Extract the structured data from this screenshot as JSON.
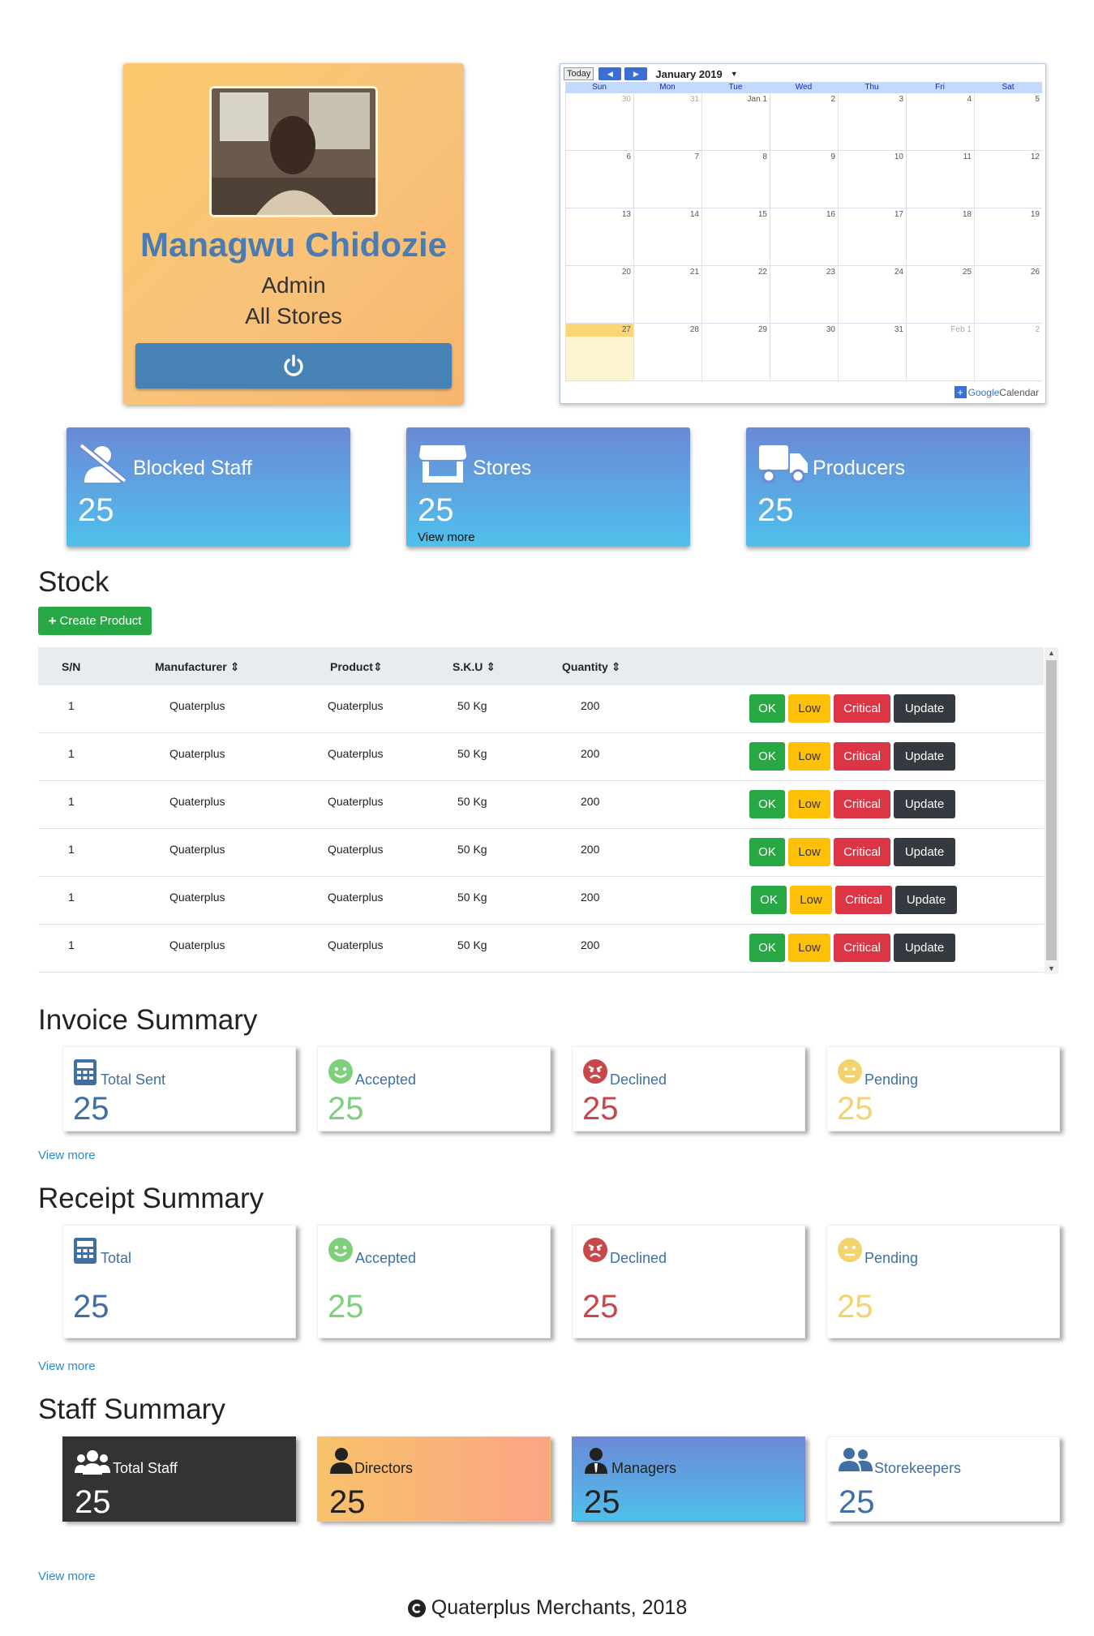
{
  "profile": {
    "name": "Managwu Chidozie",
    "role": "Admin",
    "store": "All Stores",
    "logout_icon": "power-icon"
  },
  "calendar": {
    "today_label": "Today",
    "month": "January 2019",
    "days_of_week": [
      "Sun",
      "Mon",
      "Tue",
      "Wed",
      "Thu",
      "Fri",
      "Sat"
    ],
    "weeks": [
      [
        "30",
        "31",
        "Jan 1",
        "2",
        "3",
        "4",
        "5"
      ],
      [
        "6",
        "7",
        "8",
        "9",
        "10",
        "11",
        "12"
      ],
      [
        "13",
        "14",
        "15",
        "16",
        "17",
        "18",
        "19"
      ],
      [
        "20",
        "21",
        "22",
        "23",
        "24",
        "25",
        "26"
      ],
      [
        "27",
        "28",
        "29",
        "30",
        "31",
        "Feb 1",
        "2"
      ]
    ],
    "highlight": "27",
    "brand_google": "Google",
    "brand_calendar": "Calendar"
  },
  "stats": [
    {
      "icon": "user-slash-icon",
      "label": "Blocked Staff",
      "value": "25",
      "more": ""
    },
    {
      "icon": "store-icon",
      "label": "Stores",
      "value": "25",
      "more": "View more"
    },
    {
      "icon": "truck-icon",
      "label": "Producers",
      "value": "25",
      "more": ""
    }
  ],
  "stock": {
    "title": "Stock",
    "create_label": "Create Product",
    "columns": [
      "S/N",
      "Manufacturer",
      "Product",
      "S.K.U",
      "Quantity"
    ],
    "rows": [
      {
        "sn": "1",
        "manufacturer": "Quaterplus",
        "product": "Quaterplus",
        "sku": "50 Kg",
        "quantity": "200"
      },
      {
        "sn": "1",
        "manufacturer": "Quaterplus",
        "product": "Quaterplus",
        "sku": "50 Kg",
        "quantity": "200"
      },
      {
        "sn": "1",
        "manufacturer": "Quaterplus",
        "product": "Quaterplus",
        "sku": "50 Kg",
        "quantity": "200"
      },
      {
        "sn": "1",
        "manufacturer": "Quaterplus",
        "product": "Quaterplus",
        "sku": "50 Kg",
        "quantity": "200"
      },
      {
        "sn": "1",
        "manufacturer": "Quaterplus",
        "product": "Quaterplus",
        "sku": "50 Kg",
        "quantity": "200"
      },
      {
        "sn": "1",
        "manufacturer": "Quaterplus",
        "product": "Quaterplus",
        "sku": "50 Kg",
        "quantity": "200"
      }
    ],
    "actions": {
      "ok": "OK",
      "low": "Low",
      "critical": "Critical",
      "update": "Update"
    }
  },
  "invoice": {
    "title": "Invoice Summary",
    "cards": [
      {
        "icon": "calculator-icon",
        "label": "Total Sent",
        "value": "25",
        "color": "#3f6fa3"
      },
      {
        "icon": "smile-icon",
        "label": "Accepted",
        "value": "25",
        "color": "#7ed07b"
      },
      {
        "icon": "angry-icon",
        "label": "Declined",
        "value": "25",
        "color": "#c8474b"
      },
      {
        "icon": "meh-icon",
        "label": "Pending",
        "value": "25",
        "color": "#f3d36e"
      }
    ],
    "more": "View more"
  },
  "receipt": {
    "title": "Receipt Summary",
    "cards": [
      {
        "icon": "calculator-icon",
        "label": "Total",
        "value": "25",
        "color": "#3f6fa3"
      },
      {
        "icon": "smile-icon",
        "label": "Accepted",
        "value": "25",
        "color": "#7ed07b"
      },
      {
        "icon": "angry-icon",
        "label": "Declined",
        "value": "25",
        "color": "#c8474b"
      },
      {
        "icon": "meh-icon",
        "label": "Pending",
        "value": "25",
        "color": "#f3d36e"
      }
    ],
    "more": "View more"
  },
  "staff": {
    "title": "Staff Summary",
    "cards": [
      {
        "icon": "users-icon",
        "label": "Total Staff",
        "value": "25"
      },
      {
        "icon": "user-icon",
        "label": "Directors",
        "value": "25"
      },
      {
        "icon": "user-tie-icon",
        "label": "Managers",
        "value": "25"
      },
      {
        "icon": "user-friends-icon",
        "label": "Storekeepers",
        "value": "25"
      }
    ],
    "more": "View more"
  },
  "footer": {
    "text": "Quaterplus Merchants, 2018"
  },
  "colors": {
    "primary": "#4682b4",
    "success": "#28a745",
    "warning": "#ffc107",
    "danger": "#dc3545",
    "dark": "#343a40"
  }
}
